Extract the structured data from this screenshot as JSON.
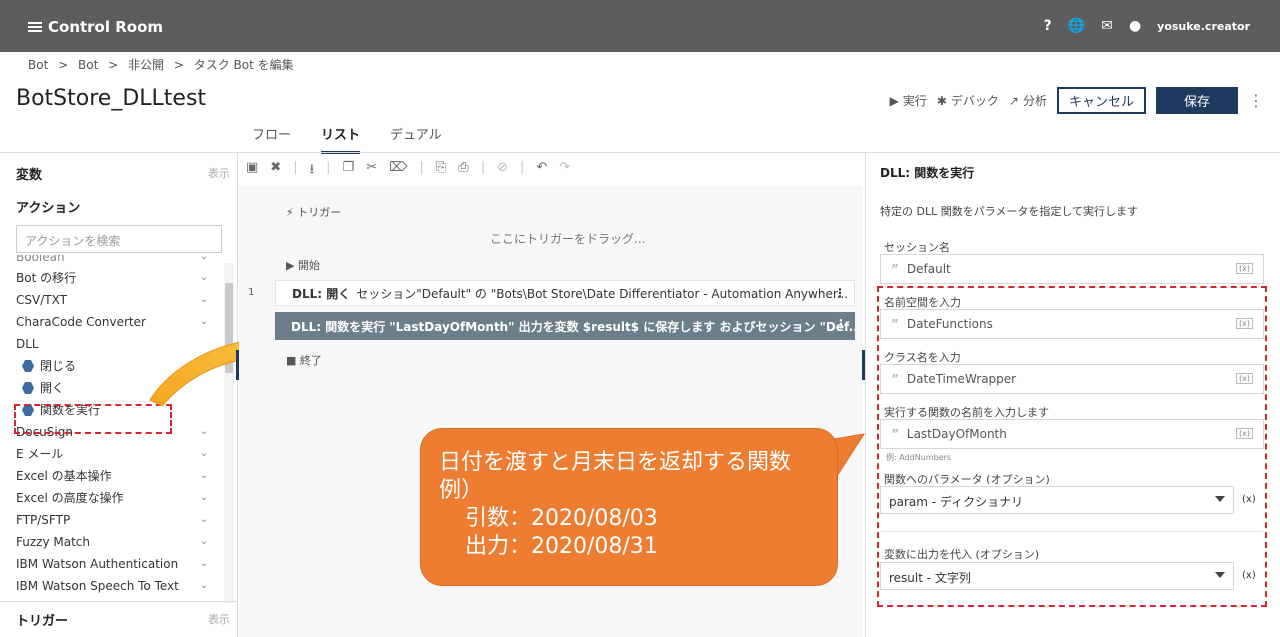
{
  "topbar": {
    "brand": "Control Room",
    "help_icon": "?",
    "user": "yosuke.creator"
  },
  "breadcrumb": [
    "Bot",
    ">",
    "Bot",
    ">",
    "非公開",
    ">",
    "タスク Bot を編集"
  ],
  "bot": {
    "title": "BotStore_DLLtest",
    "run_label": "実行",
    "debug_label": "デバック",
    "analyze_label": "分析",
    "cancel_label": "キャンセル",
    "save_label": "保存"
  },
  "tabs": [
    {
      "label": "フロー"
    },
    {
      "label": "リスト"
    },
    {
      "label": "デュアル"
    }
  ],
  "left": {
    "variables_label": "変数",
    "show_label": "表示",
    "actions_label": "アクション",
    "search_placeholder": "アクションを検索",
    "items": [
      {
        "label": "Boolean"
      },
      {
        "label": "Bot の移行"
      },
      {
        "label": "CSV/TXT"
      },
      {
        "label": "CharaCode Converter"
      },
      {
        "label": "DLL"
      },
      {
        "label": "閉じる"
      },
      {
        "label": "開く"
      },
      {
        "label": "関数を実行"
      },
      {
        "label": "DocuSign"
      },
      {
        "label": "E メール"
      },
      {
        "label": "Excel の基本操作"
      },
      {
        "label": "Excel の高度な操作"
      },
      {
        "label": "FTP/SFTP"
      },
      {
        "label": "Fuzzy Match"
      },
      {
        "label": "IBM Watson Authentication"
      },
      {
        "label": "IBM Watson Speech To Text"
      }
    ],
    "trigger_label": "トリガー",
    "trigger_show": "表示"
  },
  "center": {
    "trigger_row": "トリガー",
    "drag_hint": "ここにトリガーをドラッグ...",
    "start_row": "開始",
    "line_number": "1",
    "step1_bold": "DLL: 開く",
    "step1_text": "セッション\"Default\" の \"Bots\\Bot Store\\Date Differentiator - Automation Anywher...",
    "step2_text": "DLL: 関数を実行 \"LastDayOfMonth\" 出力を変数 $result$ に保存します およびセッション \"Def...",
    "end_row": "終了"
  },
  "callout": {
    "line1": "日付を渡すと月末日を返却する関数",
    "line2": "例）",
    "line3": "引数：2020/08/03",
    "line4": "出力：2020/08/31"
  },
  "right": {
    "title": "DLL: 関数を実行",
    "description": "特定の DLL 関数をパラメータを指定して実行します",
    "session_label": "セッション名",
    "session_value": "Default",
    "namespace_label": "名前空間を入力",
    "namespace_value": "DateFunctions",
    "class_label": "クラス名を入力",
    "class_value": "DateTimeWrapper",
    "function_label": "実行する関数の名前を入力します",
    "function_value": "LastDayOfMonth",
    "function_hint": "例: AddNumbers",
    "param_label": "関数へのパラメータ (オプション)",
    "param_value": "param - ディクショナリ",
    "output_label": "変数に出力を代入 (オプション)",
    "output_value": "result - 文字列",
    "var_marker": "(x)"
  }
}
